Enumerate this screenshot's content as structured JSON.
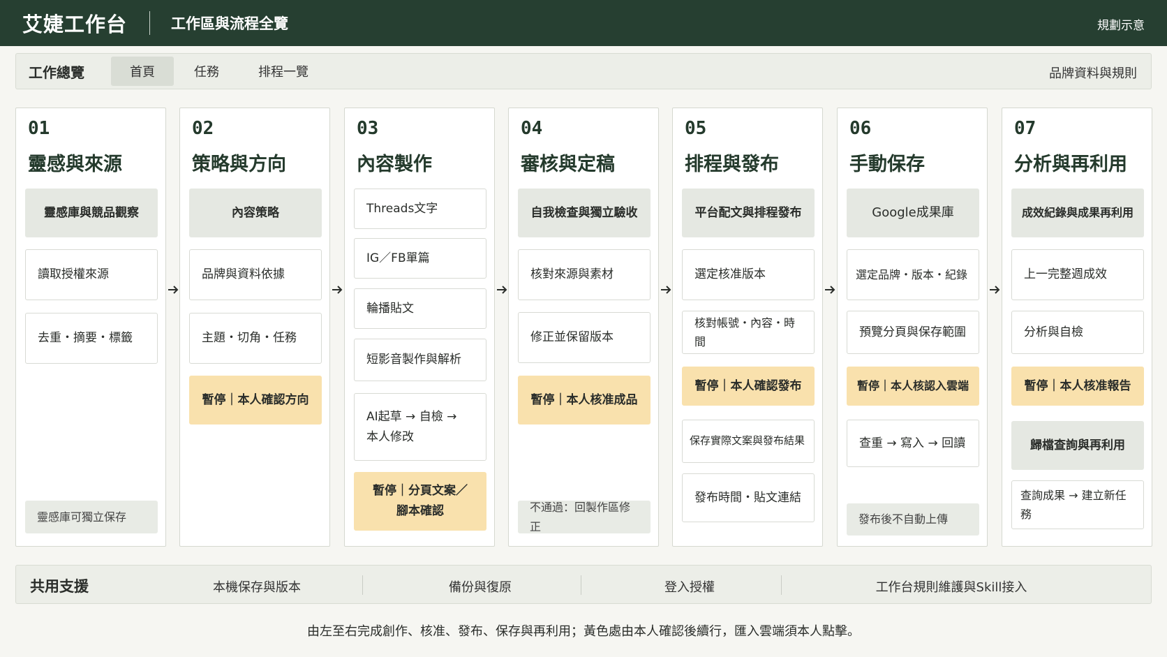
{
  "header": {
    "app_title": "艾婕工作台",
    "page_title": "工作區與流程全覽",
    "right_label": "規劃示意"
  },
  "nav": {
    "title": "工作總覽",
    "tabs": [
      "首頁",
      "任務",
      "排程一覽"
    ],
    "active_tab": "首頁",
    "right_link": "品牌資料與規則"
  },
  "columns": [
    {
      "num": "01",
      "title": "靈感與來源",
      "items": [
        "靈感庫與競品觀察",
        "讀取授權來源",
        "去重・摘要・標籤",
        "靈感庫可獨立保存"
      ]
    },
    {
      "num": "02",
      "title": "策略與方向",
      "items": [
        "內容策略",
        "品牌與資料依據",
        "主題・切角・任務",
        "暫停｜本人確認方向"
      ]
    },
    {
      "num": "03",
      "title": "內容製作",
      "items": [
        "Threads文字",
        "IG／FB單篇",
        "輪播貼文",
        "短影音製作與解析",
        "AI起草 → 自檢 →",
        "本人修改",
        "暫停｜分頁文案／",
        "腳本確認"
      ]
    },
    {
      "num": "04",
      "title": "審核與定稿",
      "items": [
        "自我檢查與獨立驗收",
        "核對來源與素材",
        "修正並保留版本",
        "暫停｜本人核准成品",
        "不通過：回製作區修正"
      ]
    },
    {
      "num": "05",
      "title": "排程與發布",
      "items": [
        "平台配文與排程發布",
        "選定核准版本",
        "核對帳號・內容・時間",
        "暫停｜本人確認發布",
        "保存實際文案與發布結果",
        "發布時間・貼文連結"
      ]
    },
    {
      "num": "06",
      "title": "手動保存",
      "items": [
        "Google成果庫",
        "選定品牌・版本・紀錄",
        "預覽分頁與保存範圍",
        "暫停｜本人核認入雲端",
        "查重 → 寫入 → 回讀",
        "發布後不自動上傳"
      ]
    },
    {
      "num": "07",
      "title": "分析與再利用",
      "items": [
        "成效紀錄與成果再利用",
        "上一完整週成效",
        "分析與自檢",
        "暫停｜本人核准報告",
        "歸檔查詢與再利用",
        "查詢成果 → 建立新任務"
      ]
    }
  ],
  "support": {
    "title": "共用支援",
    "items": [
      "本機保存與版本",
      "備份與復原",
      "登入授權",
      "工作台規則維護與Skill接入"
    ]
  },
  "footer": "由左至右完成創作、核准、發布、保存與再利用；黃色處由本人確認後續行，匯入雲端須本人點擊。"
}
